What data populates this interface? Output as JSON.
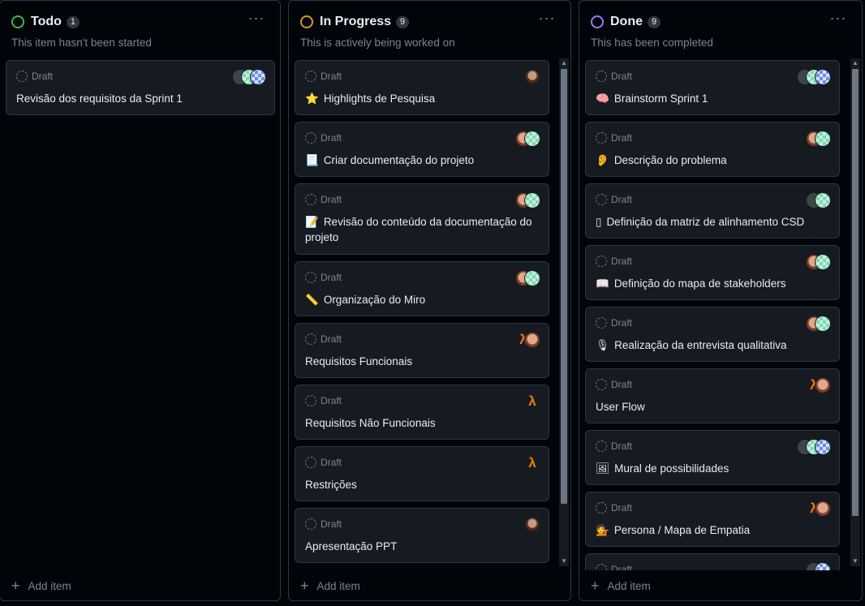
{
  "columns": [
    {
      "key": "todo",
      "title": "Todo",
      "count": "1",
      "color": "#3fb950",
      "description": "This item hasn't been started",
      "add_label": "Add item",
      "cards": [
        {
          "status": "Draft",
          "title": "Revisão dos requisitos da Sprint 1",
          "emoji": "",
          "avatars": [
            "gray",
            "mint",
            "blue"
          ]
        }
      ]
    },
    {
      "key": "progress",
      "title": "In Progress",
      "count": "9",
      "color": "#d29922",
      "description": "This is actively being worked on",
      "add_label": "Add item",
      "cards": [
        {
          "status": "Draft",
          "title": "Highlights de Pesquisa",
          "emoji": "⭐",
          "avatars": [
            "photo"
          ]
        },
        {
          "status": "Draft",
          "title": "Criar documentação do projeto",
          "emoji": "📃",
          "avatars": [
            "face",
            "mint"
          ]
        },
        {
          "status": "Draft",
          "title": "Revisão do conteúdo da documentação do projeto",
          "emoji": "📝",
          "avatars": [
            "face",
            "mint"
          ]
        },
        {
          "status": "Draft",
          "title": "Organização do Miro",
          "emoji": "📏",
          "avatars": [
            "face",
            "mint"
          ]
        },
        {
          "status": "Draft",
          "title": "Requisitos Funcionais",
          "emoji": "",
          "avatars": [
            "lambda",
            "face"
          ]
        },
        {
          "status": "Draft",
          "title": "Requisitos Não Funcionais",
          "emoji": "",
          "avatars": [
            "lambda"
          ]
        },
        {
          "status": "Draft",
          "title": "Restrições",
          "emoji": "",
          "avatars": [
            "lambda"
          ]
        },
        {
          "status": "Draft",
          "title": "Apresentação PPT",
          "emoji": "",
          "avatars": [
            "photo"
          ]
        }
      ]
    },
    {
      "key": "done",
      "title": "Done",
      "count": "9",
      "color": "#a371f7",
      "description": "This has been completed",
      "add_label": "Add item",
      "cards": [
        {
          "status": "Draft",
          "title": "Brainstorm Sprint 1",
          "emoji": "🧠",
          "avatars": [
            "gray",
            "mint",
            "blue"
          ]
        },
        {
          "status": "Draft",
          "title": "Descrição do problema",
          "emoji": "👂",
          "avatars": [
            "face",
            "mint"
          ]
        },
        {
          "status": "Draft",
          "title": "Definição da matriz de alinhamento CSD",
          "emoji": "▯",
          "avatars": [
            "green2",
            "mint"
          ]
        },
        {
          "status": "Draft",
          "title": "Definição do mapa de stakeholders",
          "emoji": "📖",
          "avatars": [
            "face",
            "mint"
          ]
        },
        {
          "status": "Draft",
          "title": "Realização da entrevista qualitativa",
          "emoji": "🎙",
          "avatars": [
            "face",
            "mint"
          ]
        },
        {
          "status": "Draft",
          "title": "User Flow",
          "emoji": "",
          "avatars": [
            "lambda",
            "face"
          ]
        },
        {
          "status": "Draft",
          "title": "Mural de possibilidades",
          "emoji": "🖼",
          "avatars": [
            "gray",
            "mint",
            "blue"
          ]
        },
        {
          "status": "Draft",
          "title": "Persona / Mapa de Empatia",
          "emoji": "💁",
          "avatars": [
            "lambda",
            "face"
          ]
        },
        {
          "status": "Draft",
          "title": "",
          "emoji": "",
          "avatars": [
            "gray",
            "blue"
          ]
        }
      ]
    }
  ]
}
